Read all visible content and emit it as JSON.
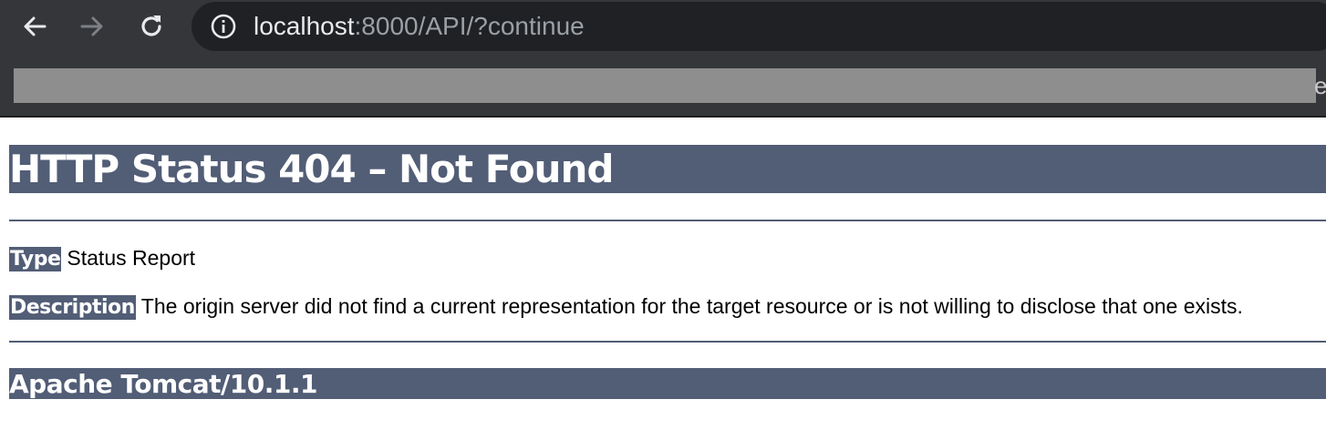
{
  "browser": {
    "back_icon": "arrow-left-icon",
    "forward_icon": "arrow-right-icon",
    "reload_icon": "reload-icon",
    "site_info_icon": "info-circle-icon",
    "url_host": "localhost",
    "url_rest": ":8000/API/?continue",
    "bookmarks_tail": "e"
  },
  "page": {
    "title": "HTTP Status 404 – Not Found",
    "type_label": "Type",
    "type_value": "Status Report",
    "description_label": "Description",
    "description_value": "The origin server did not find a current representation for the target resource or is not willing to disclose that one exists.",
    "server_footer": "Apache Tomcat/10.1.1"
  },
  "colors": {
    "chrome_bg": "#35363a",
    "omnibox_bg": "#202124",
    "tomcat_header": "#525d76",
    "redaction": "#8e8e8e"
  }
}
